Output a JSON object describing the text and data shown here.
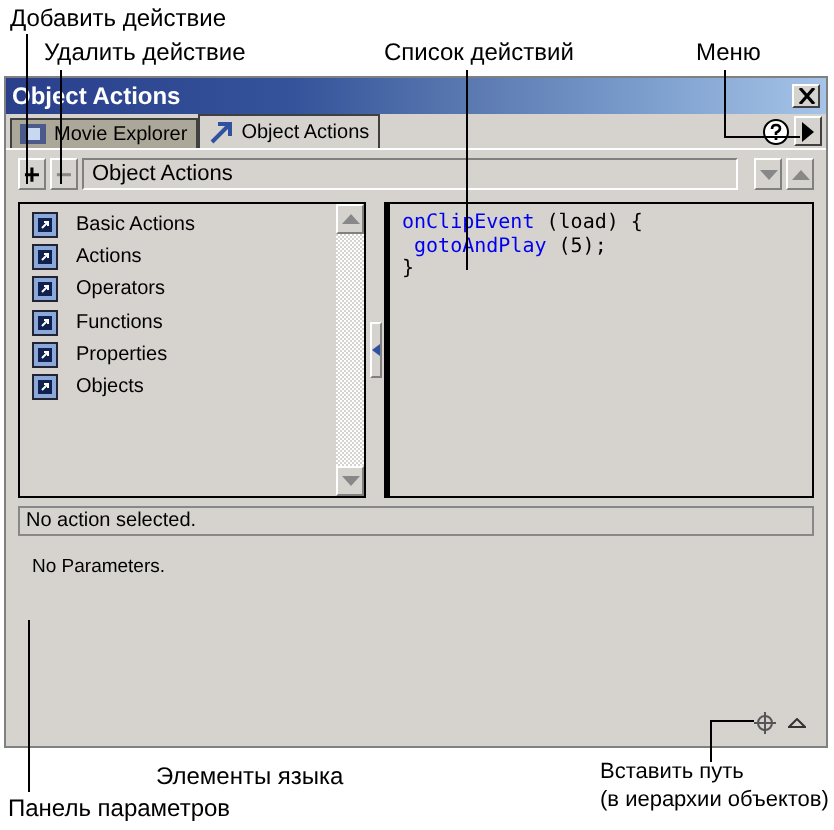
{
  "callouts_top": [
    {
      "text": "Добавить действие"
    },
    {
      "text": "Удалить действие"
    },
    {
      "text": "Список действий"
    },
    {
      "text": "Меню"
    }
  ],
  "window": {
    "title": "Object Actions"
  },
  "tabs": [
    {
      "label": "Movie Explorer",
      "selected": false
    },
    {
      "label": "Object Actions",
      "selected": true
    }
  ],
  "toolbar": {
    "add": "+",
    "remove": "−",
    "target": "Object Actions"
  },
  "toolbox": {
    "items": [
      {
        "label": "Basic Actions"
      },
      {
        "label": "Actions"
      },
      {
        "label": "Operators"
      },
      {
        "label": "Functions"
      },
      {
        "label": "Properties"
      },
      {
        "label": "Objects"
      }
    ]
  },
  "script": {
    "lines": [
      [
        {
          "text": "onClipEvent",
          "kind": "keyword"
        },
        {
          "text": " (load) {",
          "kind": "plain"
        }
      ],
      [
        {
          "text": " gotoAndPlay",
          "kind": "keyword"
        },
        {
          "text": " (5);",
          "kind": "plain"
        }
      ],
      [
        {
          "text": "}",
          "kind": "plain"
        }
      ]
    ]
  },
  "status": "No action selected.",
  "parameters": "No Parameters.",
  "callouts_bottom": [
    {
      "text": "Элементы языка"
    },
    {
      "text": "Вставить путь"
    },
    {
      "text": "Панель параметров"
    },
    {
      "text": "(в иерархии объектов)"
    }
  ]
}
